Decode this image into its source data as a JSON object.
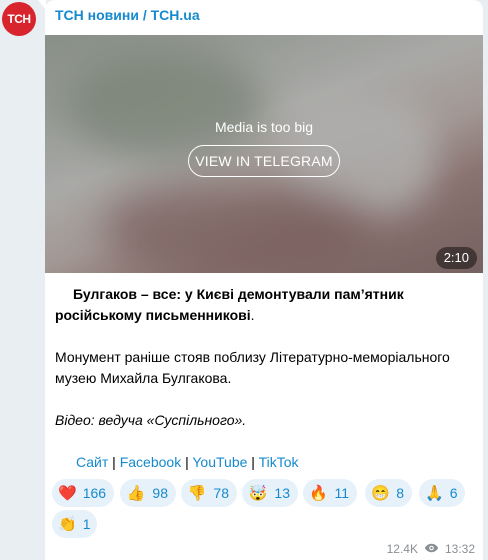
{
  "channel": {
    "avatar_text": "ТСН",
    "title": "ТСН новини / TCH.ua"
  },
  "media": {
    "note": "Media is too big",
    "button_label": "VIEW IN TELEGRAM",
    "duration": "2:10"
  },
  "post": {
    "headline": "Булгаков – все: у Києві демонтували пам’ятник російському письменникові",
    "headline_end": ".",
    "paragraph": "Монумент раніше стояв поблизу Літературно-меморіального музею Михайла Булгакова.",
    "credit": "Відео: ведуча «Суспільного»."
  },
  "links": {
    "site": "Сайт",
    "sep": " | ",
    "facebook": "Facebook",
    "youtube": "YouTube",
    "tiktok": "TikTok"
  },
  "reactions": [
    {
      "emoji": "❤️",
      "emoji_name": "heart",
      "count": "166"
    },
    {
      "emoji": "👍",
      "emoji_name": "thumbs-up",
      "count": "98"
    },
    {
      "emoji": "👎",
      "emoji_name": "thumbs-down",
      "count": "78"
    },
    {
      "emoji": "🤯",
      "emoji_name": "exploding-head",
      "count": "13"
    },
    {
      "emoji": "🔥",
      "emoji_name": "fire",
      "count": "11"
    },
    {
      "emoji": "😁",
      "emoji_name": "grinning",
      "count": "8"
    },
    {
      "emoji": "🙏",
      "emoji_name": "folded-hands",
      "count": "6"
    },
    {
      "emoji": "👏",
      "emoji_name": "clapping-hands",
      "count": "1"
    }
  ],
  "footer": {
    "views": "12.4K",
    "time": "13:32"
  },
  "colors": {
    "link": "#168acd",
    "avatar": "#d8242c",
    "reaction_bg": "#e7f1fa"
  }
}
